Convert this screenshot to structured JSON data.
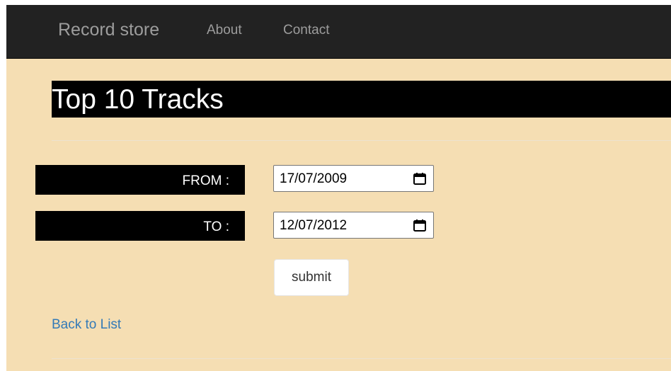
{
  "navbar": {
    "brand": "Record store",
    "links": [
      {
        "label": "About"
      },
      {
        "label": "Contact"
      }
    ]
  },
  "main": {
    "title": "Top 10 Tracks",
    "form": {
      "from_label": "FROM :",
      "from_value": "17/07/2009",
      "to_label": "TO :",
      "to_value": "12/07/2012",
      "submit_label": "submit"
    },
    "back_link": "Back to List"
  },
  "icons": {
    "calendar": "calendar-icon"
  },
  "colors": {
    "navbar_bg": "#222222",
    "navbar_text": "#9d9d9d",
    "page_bg": "#f5deb3",
    "title_bg": "#000000",
    "title_text": "#ffffff",
    "label_bg": "#000000",
    "link": "#337ab7"
  }
}
